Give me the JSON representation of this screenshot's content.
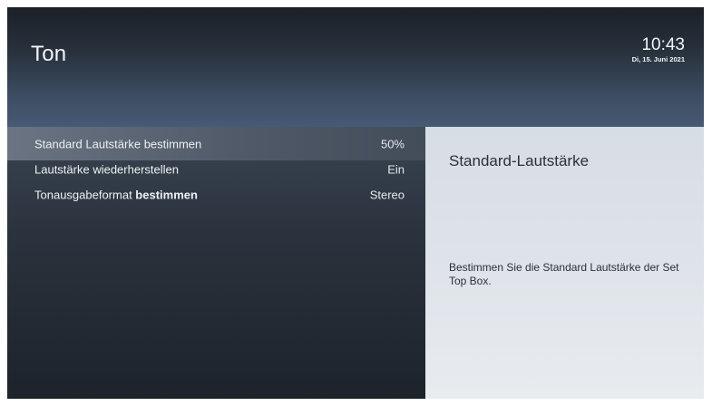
{
  "header": {
    "title": "Ton",
    "time": "10:43",
    "date": "Di, 15. Juni 2021"
  },
  "menu": {
    "items": [
      {
        "label": "Standard Lautstärke bestimmen",
        "value": "50%",
        "selected": true
      },
      {
        "label": "Lautstärke wiederherstellen",
        "value": "Ein",
        "selected": false
      },
      {
        "label_prefix": "Tonausgabeformat ",
        "label_bold": "bestimmen",
        "value": "Stereo",
        "selected": false
      }
    ]
  },
  "detail": {
    "title": "Standard-Lautstärke",
    "description": "Bestimmen Sie die Standard Lautstärke der Set Top Box."
  }
}
